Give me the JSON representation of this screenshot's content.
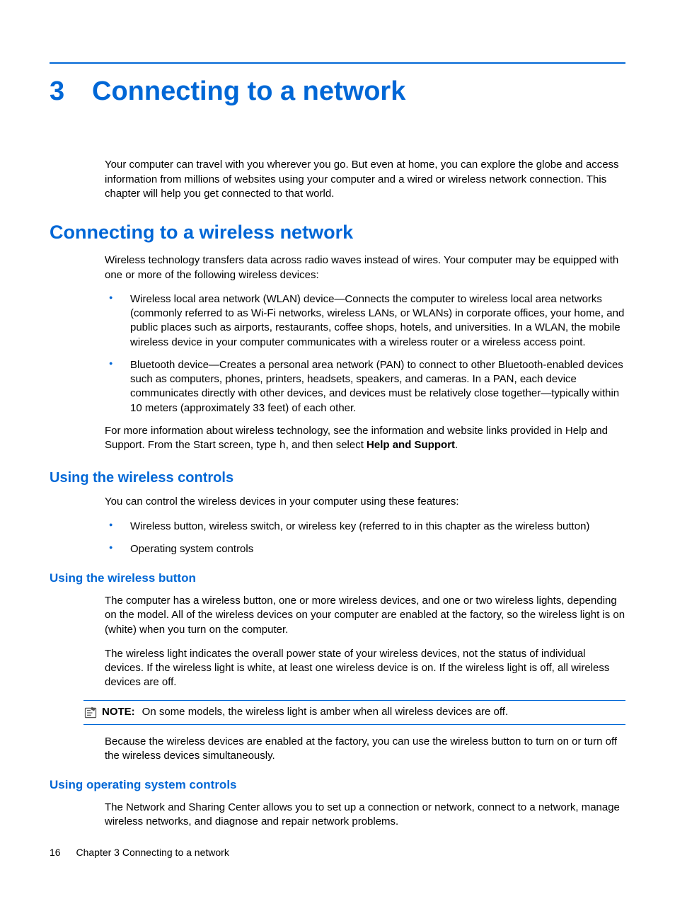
{
  "chapter": {
    "number": "3",
    "title": "Connecting to a network"
  },
  "intro_para": "Your computer can travel with you wherever you go. But even at home, you can explore the globe and access information from millions of websites using your computer and a wired or wireless network connection. This chapter will help you get connected to that world.",
  "section1": {
    "heading": "Connecting to a wireless network",
    "intro": "Wireless technology transfers data across radio waves instead of wires. Your computer may be equipped with one or more of the following wireless devices:",
    "bullets": [
      "Wireless local area network (WLAN) device—Connects the computer to wireless local area networks (commonly referred to as Wi-Fi networks, wireless LANs, or WLANs) in corporate offices, your home, and public places such as airports, restaurants, coffee shops, hotels, and universities. In a WLAN, the mobile wireless device in your computer communicates with a wireless router or a wireless access point.",
      "Bluetooth device—Creates a personal area network (PAN) to connect to other Bluetooth-enabled devices such as computers, phones, printers, headsets, speakers, and cameras. In a PAN, each device communicates directly with other devices, and devices must be relatively close together—typically within 10 meters (approximately 33 feet) of each other."
    ],
    "more_info_prefix": "For more information about wireless technology, see the information and website links provided in Help and Support. From the Start screen, type ",
    "more_info_key": "h",
    "more_info_mid": ", and then select ",
    "more_info_bold": "Help and Support",
    "more_info_suffix": "."
  },
  "section2": {
    "heading": "Using the wireless controls",
    "intro": "You can control the wireless devices in your computer using these features:",
    "bullets": [
      "Wireless button, wireless switch, or wireless key (referred to in this chapter as the wireless button)",
      "Operating system controls"
    ]
  },
  "section3": {
    "heading": "Using the wireless button",
    "p1": "The computer has a wireless button, one or more wireless devices, and one or two wireless lights, depending on the model. All of the wireless devices on your computer are enabled at the factory, so the wireless light is on (white) when you turn on the computer.",
    "p2": "The wireless light indicates the overall power state of your wireless devices, not the status of individual devices. If the wireless light is white, at least one wireless device is on. If the wireless light is off, all wireless devices are off.",
    "note_label": "NOTE:",
    "note_text": "On some models, the wireless light is amber when all wireless devices are off.",
    "p3": "Because the wireless devices are enabled at the factory, you can use the wireless button to turn on or turn off the wireless devices simultaneously."
  },
  "section4": {
    "heading": "Using operating system controls",
    "p1": "The Network and Sharing Center allows you to set up a connection or network, connect to a network, manage wireless networks, and diagnose and repair network problems."
  },
  "footer": {
    "page": "16",
    "text": "Chapter 3   Connecting to a network"
  }
}
